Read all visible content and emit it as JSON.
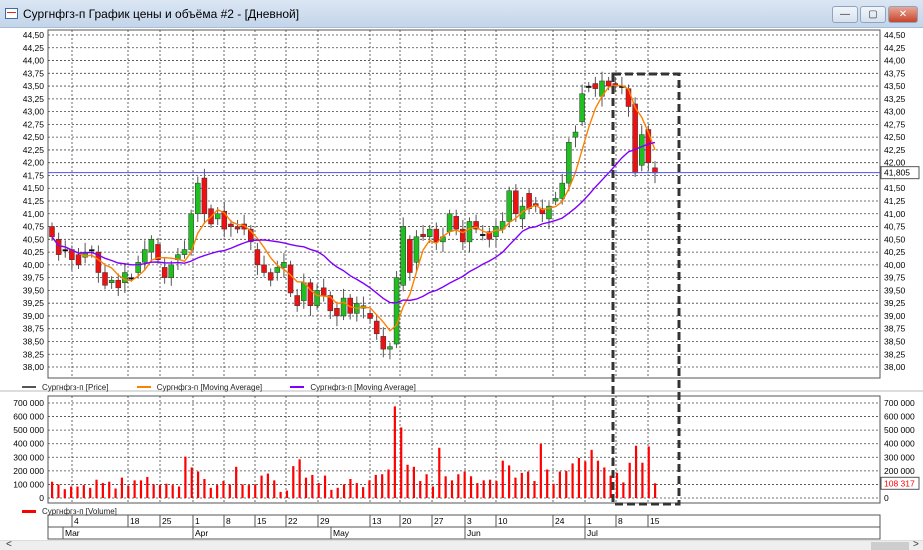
{
  "window": {
    "title": "Сургнфгз-п График цены и объёма #2 - [Дневной]",
    "minimize": "—",
    "maximize": "▢",
    "close": "✕"
  },
  "legend_price": [
    {
      "label": "Сургнфгз-п [Price]",
      "color": "#555555"
    },
    {
      "label": "Сургнфгз-п [Moving Average]",
      "color": "#ff8000"
    },
    {
      "label": "Сургнфгз-п [Moving Average]",
      "color": "#8000ff"
    }
  ],
  "legend_volume": {
    "label": "Сургнфгз-п [Volume]",
    "color": "#ff0000"
  },
  "scroll": {
    "left": "<",
    "right": ">"
  },
  "chart_data": {
    "type": "candlestick+bar",
    "price_axis": {
      "min": 38.0,
      "max": 44.5,
      "step": 0.25,
      "ticks": [
        "44,50",
        "44,25",
        "44,00",
        "43,75",
        "43,50",
        "43,25",
        "43,00",
        "42,75",
        "42,50",
        "42,25",
        "42,00",
        "41,75",
        "41,50",
        "41,25",
        "41,00",
        "40,75",
        "40,50",
        "40,25",
        "40,00",
        "39,75",
        "39,50",
        "39,25",
        "39,00",
        "38,75",
        "38,50",
        "38,25",
        "38,00"
      ]
    },
    "last_price": 41.805,
    "last_price_label": "41,805",
    "volume_axis": {
      "min": 0,
      "max": 700000,
      "ticks": [
        "700 000",
        "600 000",
        "500 000",
        "400 000",
        "300 000",
        "200 000",
        "100 000",
        "0"
      ]
    },
    "last_volume_label": "108 317",
    "date_ticks": [
      "4",
      "18",
      "25",
      "1",
      "8",
      "15",
      "22",
      "29",
      "13",
      "20",
      "27",
      "3",
      "10",
      "24",
      "1",
      "8",
      "15"
    ],
    "months": [
      "Mar",
      "Apr",
      "May",
      "Jun",
      "Jul"
    ],
    "candles": [
      [
        40.75,
        40.55
      ],
      [
        40.5,
        40.2
      ],
      [
        40.3,
        40.3
      ],
      [
        40.3,
        40.1
      ],
      [
        40.2,
        40.0
      ],
      [
        40.15,
        40.25
      ],
      [
        40.3,
        40.3
      ],
      [
        40.25,
        39.85
      ],
      [
        39.85,
        39.6
      ],
      [
        39.65,
        39.7
      ],
      [
        39.7,
        39.55
      ],
      [
        39.65,
        39.85
      ],
      [
        39.75,
        39.75
      ],
      [
        39.85,
        40.05
      ],
      [
        40.05,
        40.3
      ],
      [
        40.25,
        40.5
      ],
      [
        40.4,
        40.1
      ],
      [
        39.95,
        39.75
      ],
      [
        39.75,
        40.0
      ],
      [
        40.1,
        40.2
      ],
      [
        40.2,
        40.3
      ],
      [
        40.3,
        41.0
      ],
      [
        41.0,
        41.6
      ],
      [
        41.7,
        41.0
      ],
      [
        41.1,
        40.8
      ],
      [
        40.9,
        41.0
      ],
      [
        41.05,
        40.7
      ],
      [
        40.8,
        40.75
      ],
      [
        40.75,
        40.7
      ],
      [
        40.8,
        40.7
      ],
      [
        40.7,
        40.45
      ],
      [
        40.3,
        40.0
      ],
      [
        40.0,
        39.85
      ],
      [
        39.85,
        39.7
      ],
      [
        39.85,
        39.95
      ],
      [
        39.95,
        40.05
      ],
      [
        40.0,
        39.45
      ],
      [
        39.4,
        39.2
      ],
      [
        39.3,
        39.65
      ],
      [
        39.65,
        39.2
      ],
      [
        39.2,
        39.5
      ],
      [
        39.55,
        39.4
      ],
      [
        39.4,
        39.1
      ],
      [
        39.15,
        39.0
      ],
      [
        39.0,
        39.35
      ],
      [
        39.35,
        39.05
      ],
      [
        39.05,
        39.25
      ],
      [
        39.15,
        39.2
      ],
      [
        39.05,
        38.95
      ],
      [
        38.9,
        38.65
      ],
      [
        38.6,
        38.35
      ],
      [
        38.35,
        38.4
      ],
      [
        38.45,
        39.75
      ],
      [
        39.6,
        40.75
      ],
      [
        40.5,
        39.85
      ],
      [
        40.05,
        40.55
      ],
      [
        40.6,
        40.55
      ],
      [
        40.55,
        40.7
      ],
      [
        40.7,
        40.45
      ],
      [
        40.45,
        40.55
      ],
      [
        40.65,
        41.0
      ],
      [
        40.95,
        40.7
      ],
      [
        40.7,
        40.45
      ],
      [
        40.45,
        40.85
      ],
      [
        40.85,
        40.7
      ],
      [
        40.6,
        40.6
      ],
      [
        40.65,
        40.5
      ],
      [
        40.55,
        40.75
      ],
      [
        40.7,
        40.85
      ],
      [
        40.85,
        41.45
      ],
      [
        41.45,
        41.0
      ],
      [
        40.9,
        41.15
      ],
      [
        41.4,
        41.1
      ],
      [
        41.2,
        41.15
      ],
      [
        41.1,
        41.0
      ],
      [
        40.9,
        41.15
      ],
      [
        41.25,
        41.3
      ],
      [
        41.3,
        41.6
      ],
      [
        41.6,
        42.4
      ],
      [
        42.5,
        42.6
      ],
      [
        42.8,
        43.35
      ],
      [
        43.5,
        43.5
      ],
      [
        43.55,
        43.45
      ],
      [
        43.3,
        43.6
      ],
      [
        43.6,
        43.5
      ],
      [
        43.55,
        43.5
      ],
      [
        43.5,
        43.5
      ],
      [
        43.45,
        43.1
      ],
      [
        43.15,
        41.8
      ],
      [
        41.95,
        42.55
      ],
      [
        42.65,
        42.0
      ],
      [
        41.9,
        41.8
      ]
    ],
    "volumes": [
      120000,
      100000,
      65000,
      85000,
      85000,
      95000,
      75000,
      135000,
      110000,
      120000,
      70000,
      150000,
      90000,
      130000,
      130000,
      155000,
      100000,
      95000,
      105000,
      95000,
      85000,
      305000,
      225000,
      195000,
      140000,
      75000,
      95000,
      125000,
      100000,
      230000,
      100000,
      95000,
      100000,
      165000,
      180000,
      130000,
      45000,
      55000,
      235000,
      285000,
      150000,
      170000,
      110000,
      165000,
      60000,
      75000,
      100000,
      140000,
      110000,
      80000,
      130000,
      170000,
      175000,
      210000,
      675000,
      520000,
      245000,
      230000,
      125000,
      175000,
      85000,
      370000,
      160000,
      130000,
      175000,
      195000,
      160000,
      110000,
      130000,
      135000,
      125000,
      275000,
      240000,
      150000,
      185000,
      195000,
      125000,
      400000,
      210000,
      105000,
      195000,
      200000,
      255000,
      295000,
      270000,
      355000,
      275000,
      225000,
      165000,
      185000,
      115000,
      260000,
      385000,
      260000,
      380000,
      108317
    ],
    "ma_periods": [
      5,
      20
    ]
  }
}
